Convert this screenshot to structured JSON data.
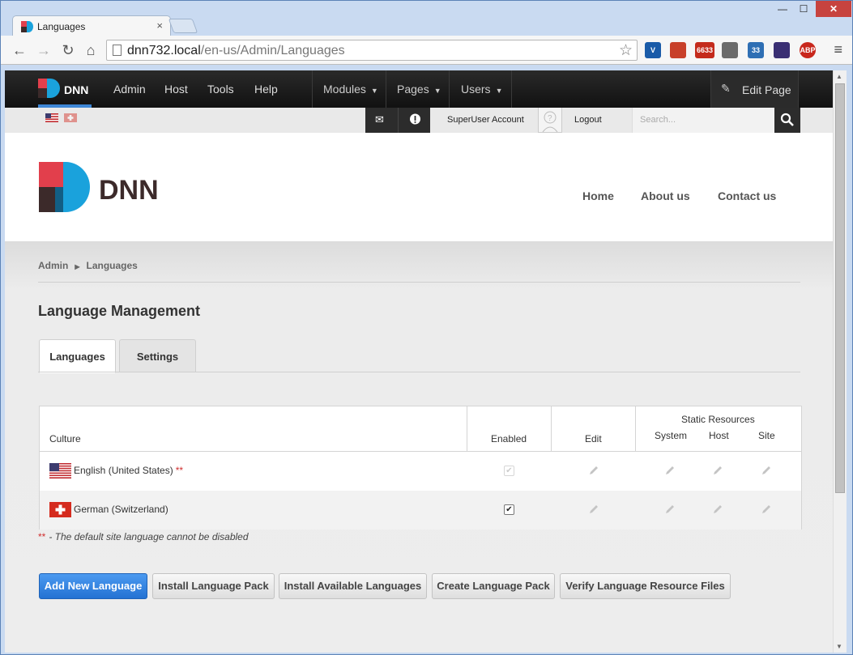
{
  "browser": {
    "tab_title": "Languages",
    "tab_close": "×",
    "url_host": "dnn732.local",
    "url_path": "/en-us/Admin/Languages",
    "window_controls": {
      "minimize": "—",
      "maximize": "☐",
      "close": "✕"
    },
    "extensions": [
      {
        "name": "v-icon",
        "label": "V",
        "color": "#1a5ba8"
      },
      {
        "name": "book-icon",
        "label": "",
        "color": "#c8402a"
      },
      {
        "name": "gmail-icon",
        "label": "6633",
        "color": "#c42b1c"
      },
      {
        "name": "keyboard-icon",
        "label": "",
        "color": "#6b6b6b"
      },
      {
        "name": "calendar-icon",
        "label": "33",
        "color": "#2f6fb4"
      },
      {
        "name": "nightsky-icon",
        "label": "",
        "color": "#3a2f73"
      },
      {
        "name": "abp-icon",
        "label": "ABP",
        "color": "#c8271c"
      }
    ]
  },
  "controlbar": {
    "logo_text": "DNN",
    "menu": [
      "Admin",
      "Host",
      "Tools",
      "Help"
    ],
    "dropdowns": [
      "Modules",
      "Pages",
      "Users"
    ],
    "edit_page": "Edit Page"
  },
  "userbar": {
    "account": "SuperUser Account",
    "logout": "Logout",
    "search_placeholder": "Search..."
  },
  "header": {
    "logo_text": "DNN",
    "nav": [
      "Home",
      "About us",
      "Contact us"
    ]
  },
  "breadcrumb": [
    "Admin",
    "Languages"
  ],
  "page_title": "Language Management",
  "tabs": [
    "Languages",
    "Settings"
  ],
  "table": {
    "columns": {
      "culture": "Culture",
      "enabled": "Enabled",
      "edit": "Edit",
      "static_group": "Static Resources",
      "system": "System",
      "host": "Host",
      "site": "Site"
    },
    "rows": [
      {
        "culture": "English (United States)",
        "marker": "**",
        "enabled": true,
        "enabled_locked": true
      },
      {
        "culture": "German (Switzerland)",
        "marker": "",
        "enabled": true,
        "enabled_locked": false
      }
    ]
  },
  "note": {
    "marker": "**",
    "text": "- The default site language cannot be disabled"
  },
  "buttons": [
    "Add New Language",
    "Install Language Pack",
    "Install Available Languages",
    "Create Language Pack",
    "Verify Language Resource Files"
  ]
}
